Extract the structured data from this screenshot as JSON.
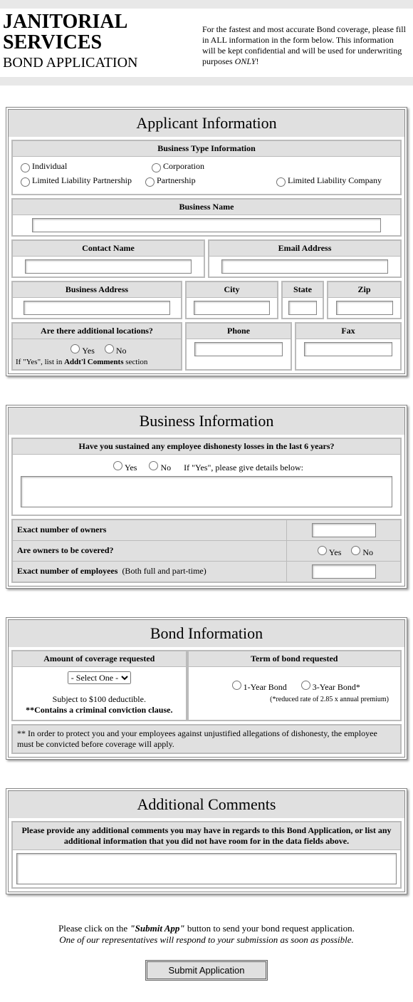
{
  "header": {
    "title1": "JANITORIAL",
    "title2": "SERVICES",
    "subtitle": "BOND APPLICATION",
    "intro_a": "For the fastest and most accurate Bond coverage, please fill in ALL information in the form below. This information will be kept confidential and will be used for underwriting purposes ",
    "intro_b": "ONLY",
    "intro_c": "!"
  },
  "s1": {
    "title": "Applicant Information",
    "biztype_h": "Business Type Information",
    "opts": {
      "o1": "Individual",
      "o2": "Corporation",
      "o3": "Limited Liability Partnership",
      "o4": "Partnership",
      "o5": "Limited Liability Company"
    },
    "bizname_h": "Business Name",
    "contact_h": "Contact Name",
    "email_h": "Email Address",
    "addr_h": "Business Address",
    "city_h": "City",
    "state_h": "State",
    "zip_h": "Zip",
    "addloc_h": "Are there additional locations?",
    "phone_h": "Phone",
    "fax_h": "Fax",
    "yes": "Yes",
    "no": "No",
    "addloc_note_a": "If \"Yes\", list in ",
    "addloc_note_b": "Addt'l Comments",
    "addloc_note_c": " section"
  },
  "s2": {
    "title": "Business Information",
    "q1_h": "Have you sustained any employee dishonesty losses in the last 6 years?",
    "yes": "Yes",
    "no": "No",
    "q1_detail": "If \"Yes\", please give details below:",
    "row1": "Exact number of owners",
    "row2": "Are owners to be covered?",
    "row3_a": "Exact number of employees",
    "row3_b": "(Both full and part-time)"
  },
  "s3": {
    "title": "Bond Information",
    "col1_h": "Amount of coverage requested",
    "col2_h": "Term of bond requested",
    "select_default": "- Select One -",
    "deduct": "Subject to $100 deductible.",
    "clause": "**Contains a criminal conviction clause.",
    "t1": "1-Year Bond",
    "t2": "3-Year Bond*",
    "t2_note": "(*reduced rate of 2.85 x annual premium)",
    "foot": "** In order to protect you and your employees against unjustified allegations of dishonesty, the employee must be convicted before coverage will apply."
  },
  "s4": {
    "title": "Additional Comments",
    "instr": "Please provide any additional comments you may have in regards to this Bond Application, or list any additional information that you did not have room for in the data fields above."
  },
  "submit": {
    "line1_a": "Please click on the ",
    "line1_b": "\"Submit App\"",
    "line1_c": " button to send your bond request application.",
    "line2": "One of our representatives will respond to your submission as soon as possible.",
    "btn": "Submit Application"
  }
}
